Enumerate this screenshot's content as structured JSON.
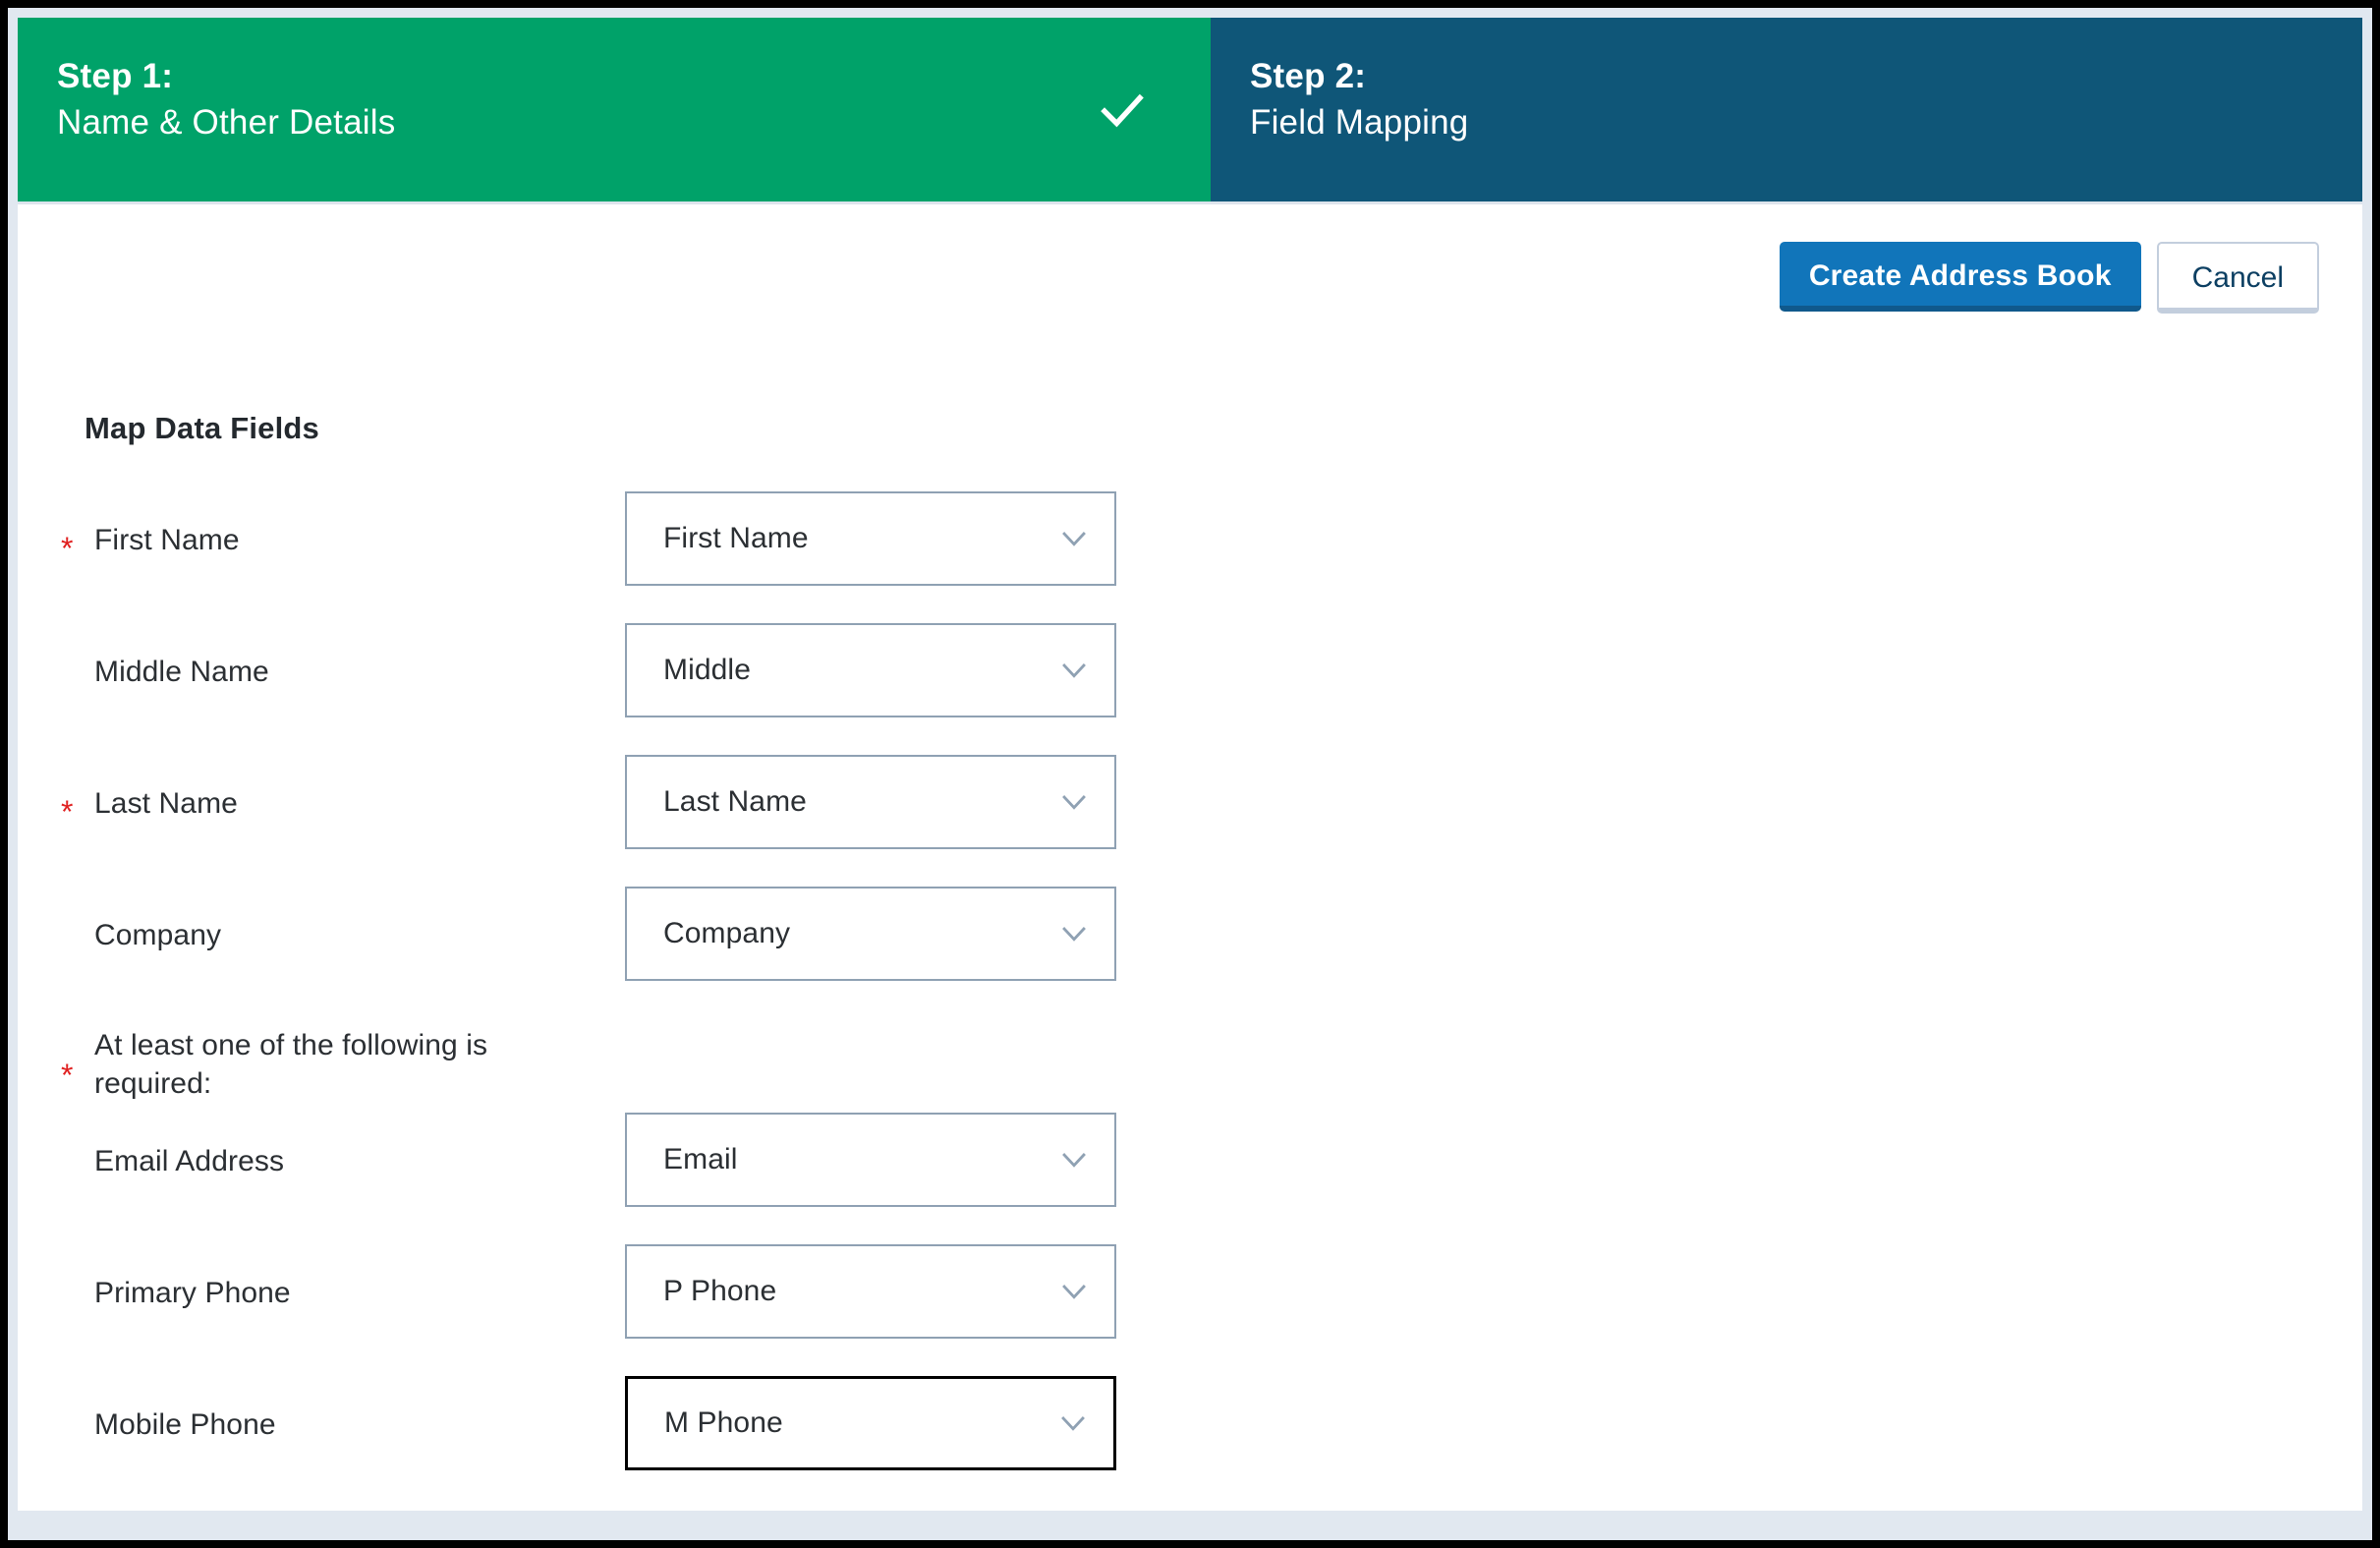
{
  "wizard": {
    "steps": [
      {
        "number": "Step 1:",
        "title": "Name & Other Details",
        "state": "complete",
        "accent": "#00a269",
        "icon": "check-icon"
      },
      {
        "number": "Step 2:",
        "title": "Field Mapping",
        "state": "active",
        "accent": "#0f5678"
      }
    ]
  },
  "toolbar": {
    "primary_label": "Create Address Book",
    "primary_color": "#1175ba",
    "secondary_label": "Cancel",
    "secondary_text_color": "#0c3f62"
  },
  "form": {
    "section_title": "Map Data Fields",
    "required_marker": "*",
    "required_color": "#e02020",
    "note": {
      "marker": "*",
      "text": "At least one of the following is required:"
    },
    "fields": [
      {
        "label": "First Name",
        "value": "First Name",
        "required": true,
        "focused": false,
        "icon": "chevron-down-icon"
      },
      {
        "label": "Middle Name",
        "value": "Middle",
        "required": false,
        "focused": false,
        "icon": "chevron-down-icon"
      },
      {
        "label": "Last Name",
        "value": "Last Name",
        "required": true,
        "focused": false,
        "icon": "chevron-down-icon"
      },
      {
        "label": "Company",
        "value": "Company",
        "required": false,
        "focused": false,
        "icon": "chevron-down-icon"
      }
    ],
    "contact_fields": [
      {
        "label": "Email Address",
        "value": "Email",
        "required": false,
        "focused": false,
        "icon": "chevron-down-icon"
      },
      {
        "label": "Primary Phone",
        "value": "P Phone",
        "required": false,
        "focused": false,
        "icon": "chevron-down-icon"
      },
      {
        "label": "Mobile Phone",
        "value": "M Phone",
        "required": false,
        "focused": true,
        "icon": "chevron-down-icon"
      }
    ]
  }
}
